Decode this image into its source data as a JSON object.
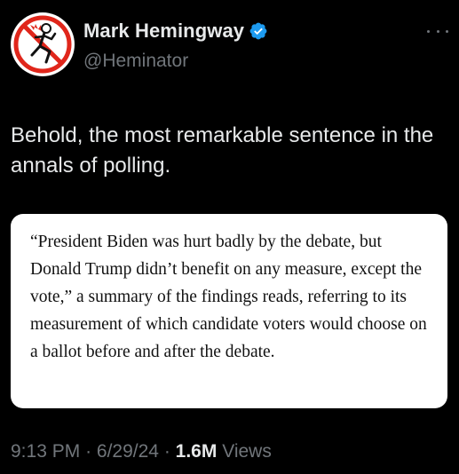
{
  "author": {
    "display_name": "Mark Hemingway",
    "handle": "@Heminator",
    "verified": true,
    "avatar_icon": "running-man-avatar-icon"
  },
  "post": {
    "text": "Behold, the most remarkable sentence in the annals of polling.",
    "quote": "“President Biden was hurt badly by the debate, but Donald Trump didn’t benefit on any measure, except the vote,” a summary of the findings reads, referring to its measurement of which candidate voters would choose on a ballot before and after the debate."
  },
  "meta": {
    "time": "9:13 PM",
    "separator": "·",
    "date": "6/29/24",
    "views_count": "1.6M",
    "views_label": "Views"
  },
  "colors": {
    "background": "#000000",
    "primary_text": "#e7e9ea",
    "secondary_text": "#71767b",
    "verified_badge": "#1d9bf0",
    "avatar_accent": "#e0261b"
  }
}
